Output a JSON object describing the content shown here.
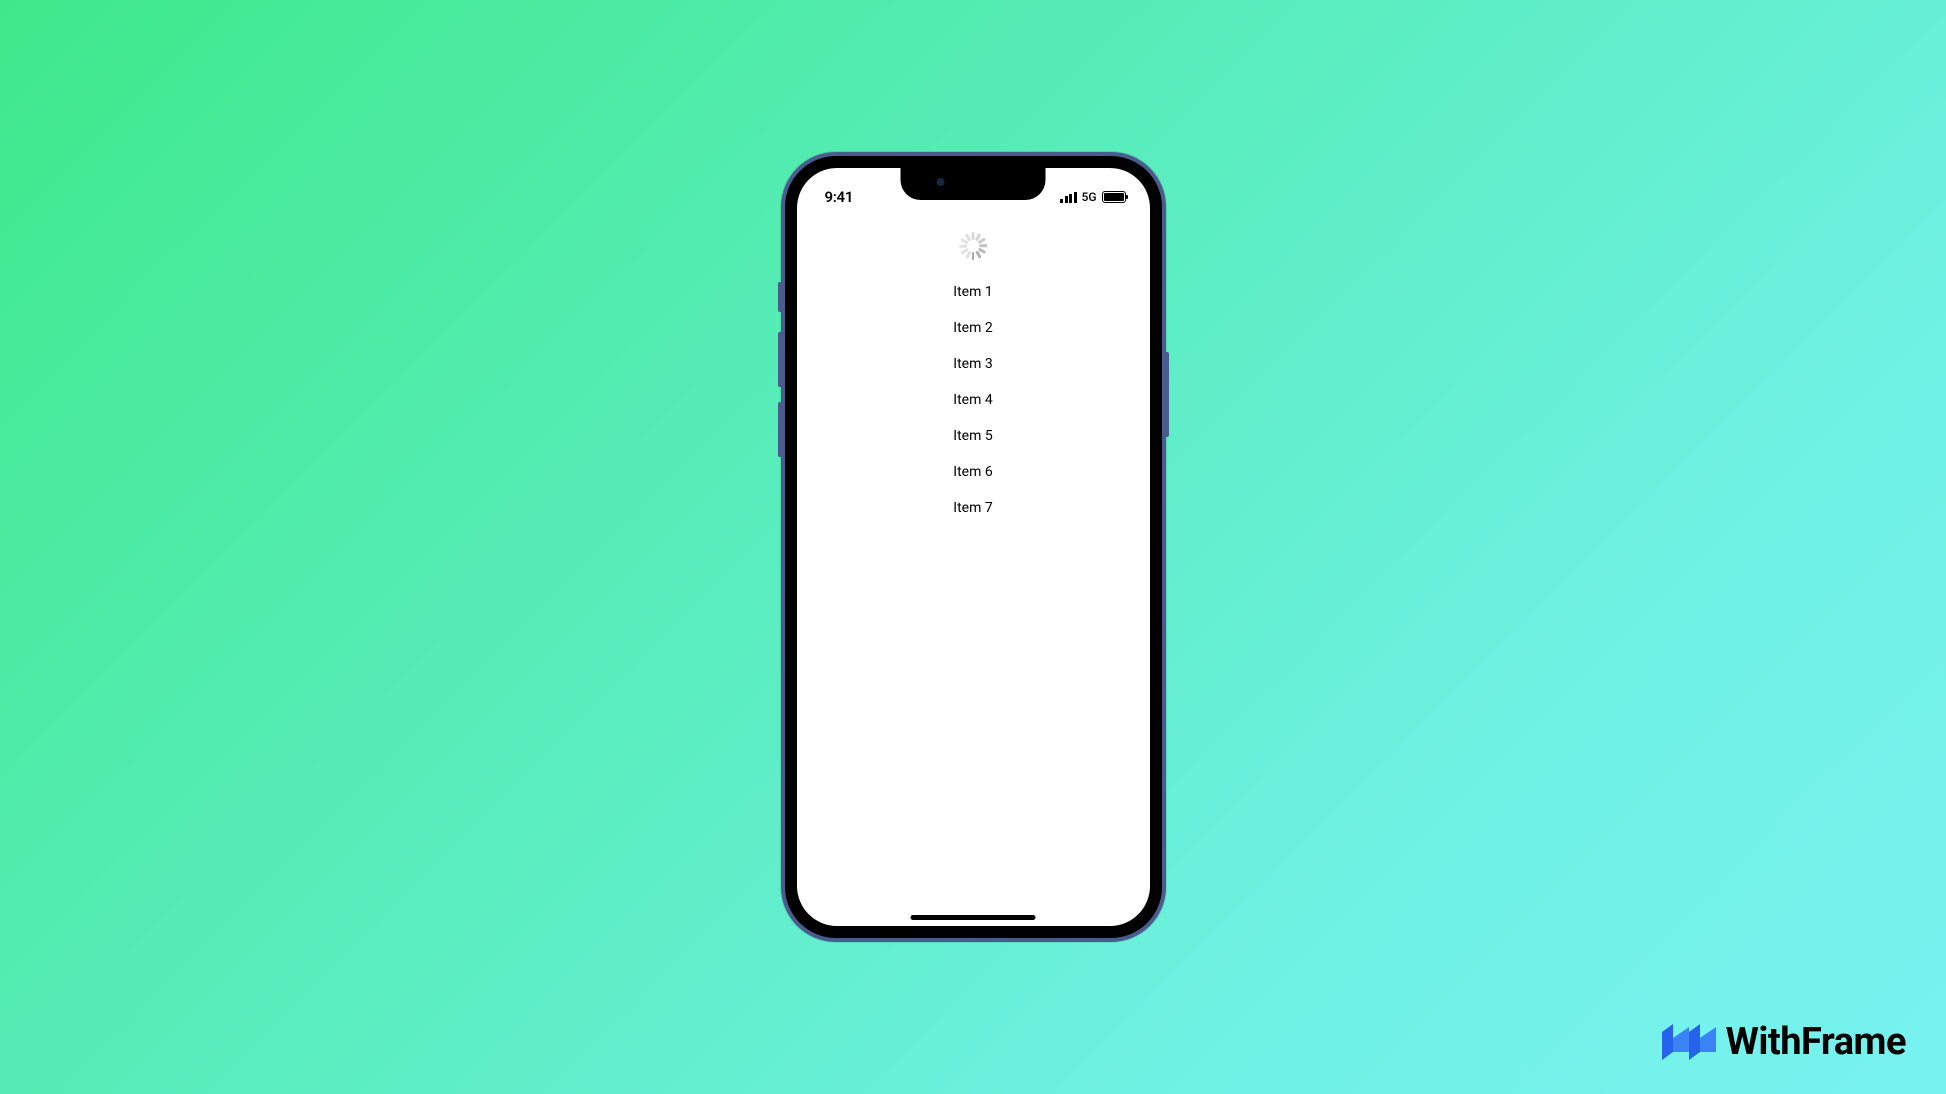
{
  "status_bar": {
    "time": "9:41",
    "network_type": "5G"
  },
  "list": {
    "items": [
      {
        "label": "Item 1"
      },
      {
        "label": "Item 2"
      },
      {
        "label": "Item 3"
      },
      {
        "label": "Item 4"
      },
      {
        "label": "Item 5"
      },
      {
        "label": "Item 6"
      },
      {
        "label": "Item 7"
      }
    ]
  },
  "watermark": {
    "text": "WithFrame"
  }
}
